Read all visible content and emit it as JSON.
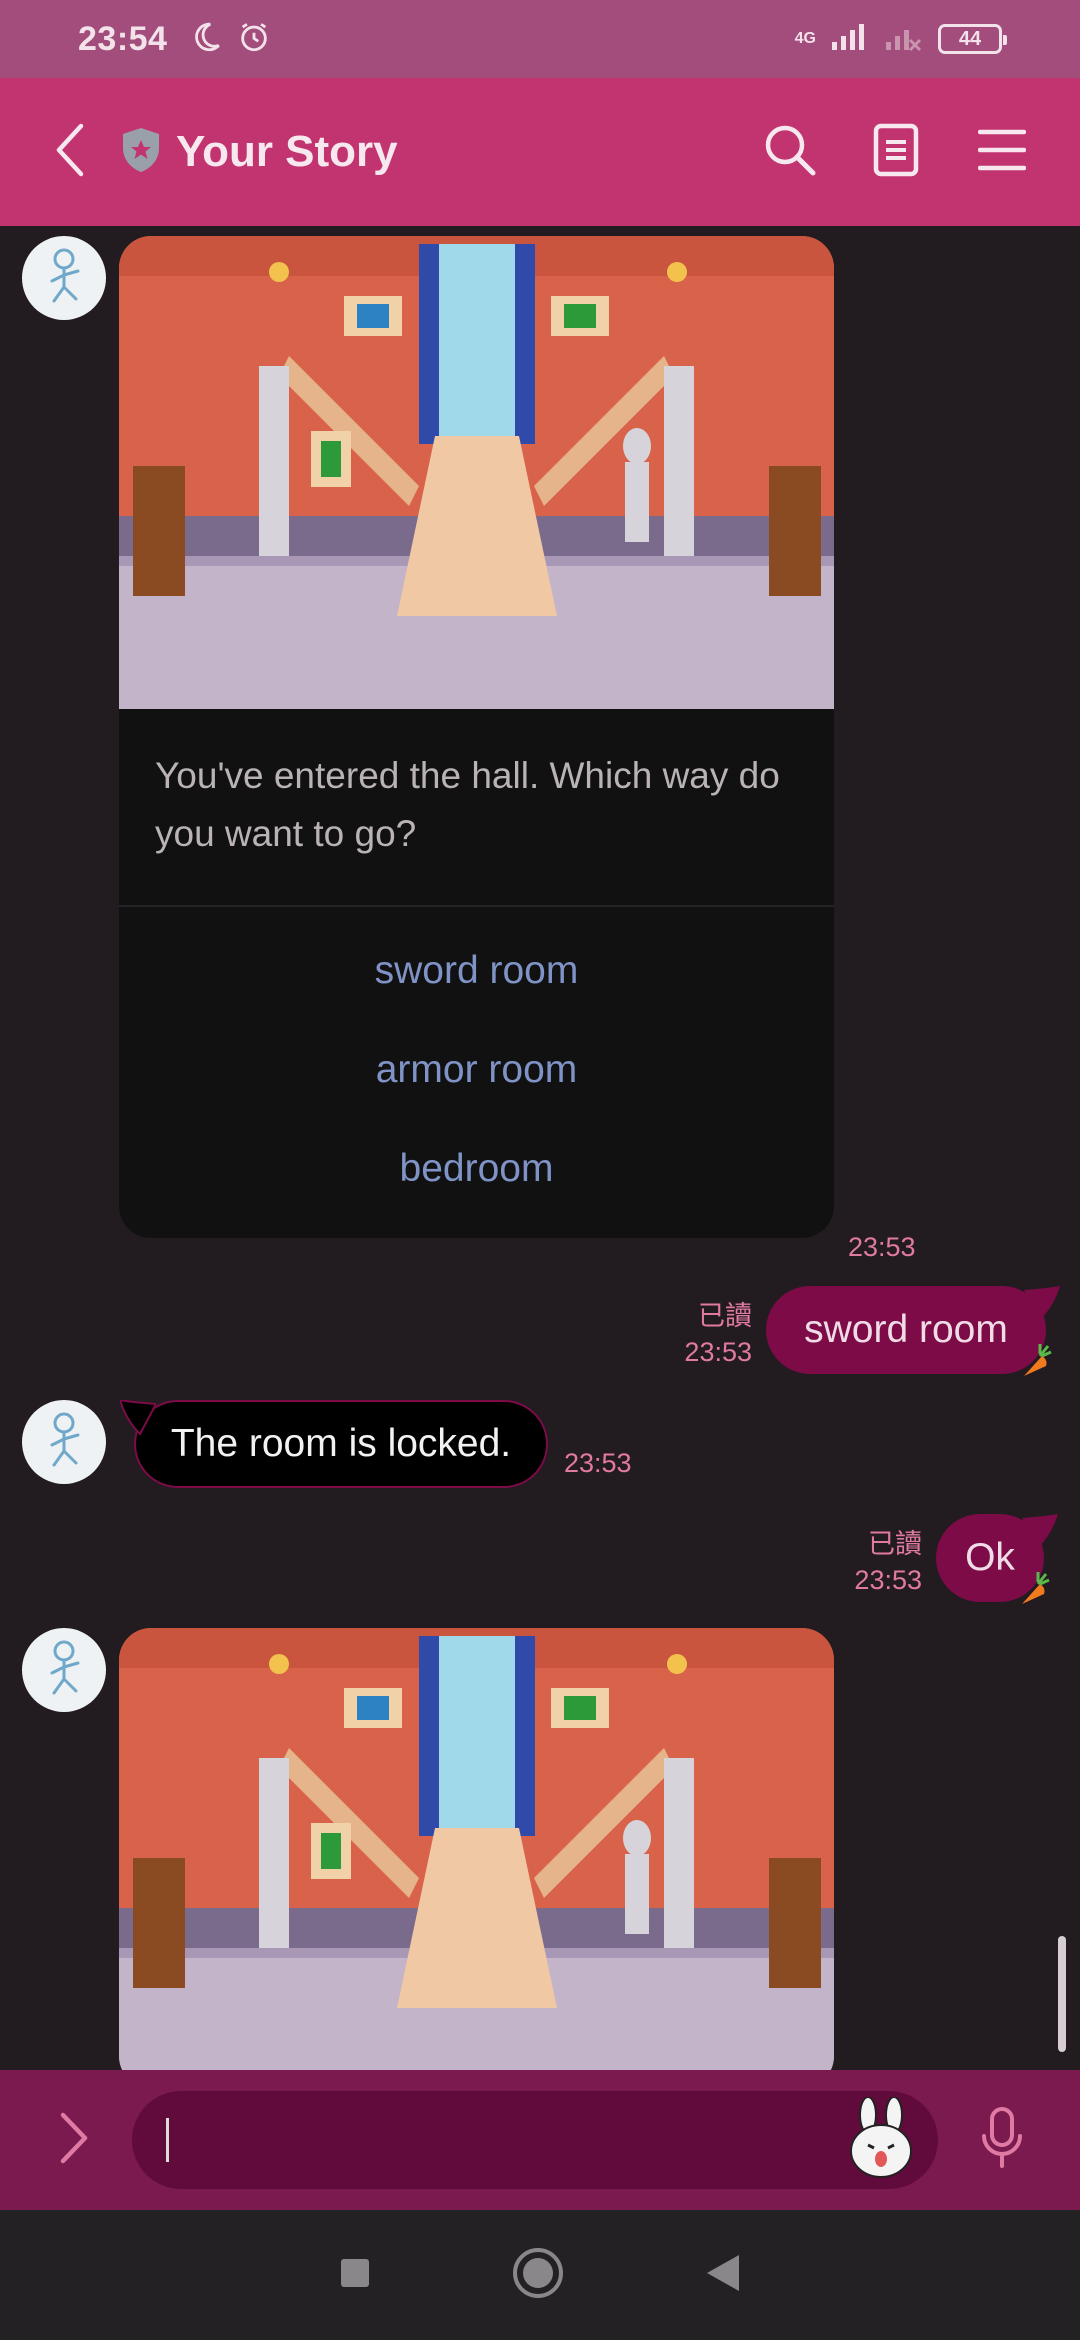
{
  "status_bar": {
    "time": "23:54",
    "network": "4G",
    "battery": "44"
  },
  "header": {
    "title": "Your Story"
  },
  "messages": {
    "card1": {
      "text": "You've entered the hall. Which way do you want to go?",
      "options": [
        "sword room",
        "armor room",
        "bedroom"
      ],
      "time": "23:53"
    },
    "out1": {
      "read": "已讀",
      "time": "23:53",
      "text": "sword room"
    },
    "in1": {
      "text": "The room is locked.",
      "time": "23:53"
    },
    "out2": {
      "read": "已讀",
      "time": "23:53",
      "text": "Ok"
    }
  },
  "input": {
    "value": ""
  },
  "colors": {
    "status_bar": "#a24d7b",
    "header": "#c2346f",
    "background": "#221b1f",
    "outgoing_bubble": "#7c0b48",
    "input_bar": "#7a1a4f",
    "timestamp": "#e07aa3",
    "option_link": "#7f93c6"
  },
  "icons": {
    "status": [
      "moon-icon",
      "alarm-icon",
      "signal-icon",
      "signal-off-icon",
      "battery-icon"
    ],
    "header": [
      "back-arrow-icon",
      "shield-star-icon",
      "search-icon",
      "document-icon",
      "menu-icon"
    ],
    "input": [
      "chevron-right-icon",
      "bunny-sticker-icon",
      "microphone-icon"
    ],
    "nav": [
      "recents-square-icon",
      "home-circle-icon",
      "back-triangle-icon"
    ]
  }
}
